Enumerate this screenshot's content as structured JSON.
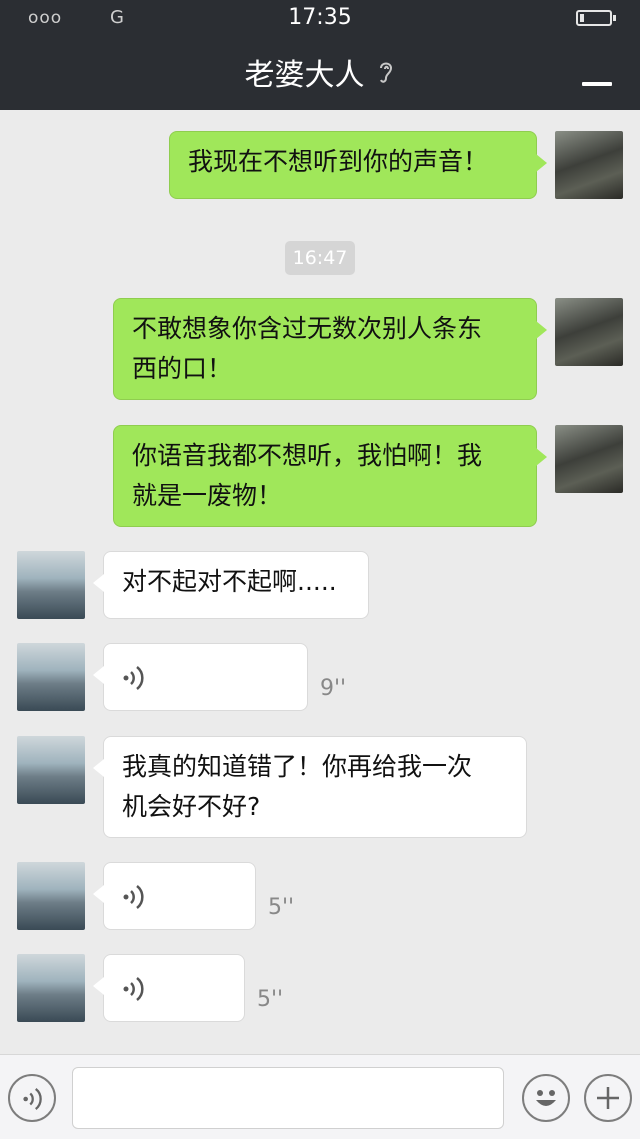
{
  "status_bar": {
    "signal": "ooo",
    "carrier": "G",
    "time": "17:35"
  },
  "header": {
    "title": "老婆大人",
    "back_label": ""
  },
  "time_separator": "16:47",
  "messages": [
    {
      "from": "me",
      "type": "text",
      "text": "我现在不想听到你的声音！"
    },
    {
      "from": "me",
      "type": "text",
      "lines": [
        "不敢想象你含过无数次别人条东",
        "西的口！"
      ]
    },
    {
      "from": "me",
      "type": "text",
      "lines": [
        "你语音我都不想听，我怕啊！我",
        "就是一废物！"
      ]
    },
    {
      "from": "her",
      "type": "text",
      "text": "对不起对不起啊....."
    },
    {
      "from": "her",
      "type": "voice",
      "duration": "9''"
    },
    {
      "from": "her",
      "type": "text",
      "lines": [
        "我真的知道错了！你再给我一次",
        "机会好不好?"
      ]
    },
    {
      "from": "her",
      "type": "voice",
      "duration": "5''"
    },
    {
      "from": "her",
      "type": "voice",
      "duration": "5''"
    }
  ],
  "input": {
    "placeholder": ""
  },
  "colors": {
    "header_bg": "#2b2e33",
    "my_bubble": "#a0e75a",
    "her_bubble": "#ffffff",
    "chat_bg": "#ebebeb"
  },
  "icons": {
    "header": "ear-icon",
    "voice": "voice-wave-icon",
    "emoji": "emoji-icon",
    "plus": "plus-icon"
  }
}
